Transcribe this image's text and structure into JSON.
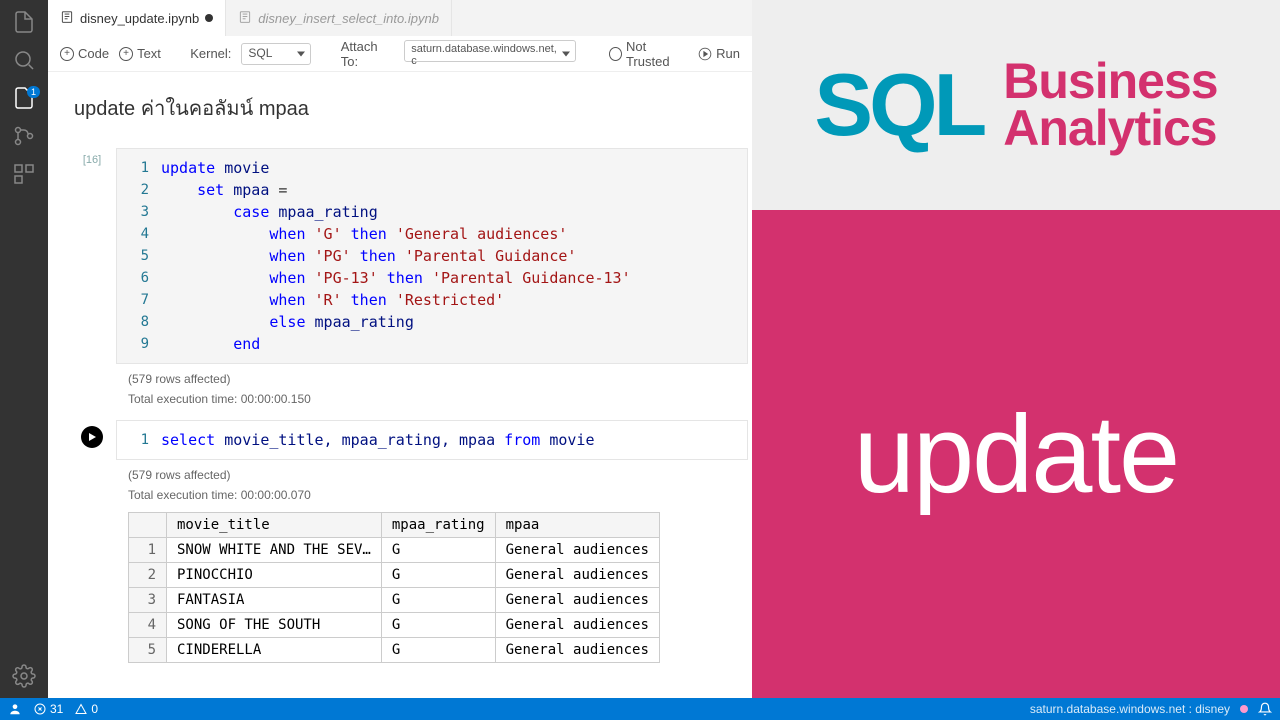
{
  "activity": {
    "badge": "1"
  },
  "tabs": [
    {
      "label": "disney_update.ipynb",
      "active": true,
      "dirty": true
    },
    {
      "label": "disney_insert_select_into.ipynb",
      "active": false,
      "dirty": false
    }
  ],
  "toolbar": {
    "code": "Code",
    "text": "Text",
    "kernel_label": "Kernel:",
    "kernel_value": "SQL",
    "attach_label": "Attach To:",
    "attach_value": "saturn.database.windows.net, c",
    "trusted": "Not Trusted",
    "run": "Run"
  },
  "heading": "update ค่าในคอลัมน์ mpaa",
  "cell1": {
    "exec_count": "[16]",
    "lines": [
      [
        {
          "t": "update",
          "c": "kw"
        },
        {
          "t": " movie",
          "c": "id"
        }
      ],
      [
        {
          "t": "    ",
          "c": "op"
        },
        {
          "t": "set",
          "c": "kw"
        },
        {
          "t": " mpaa ",
          "c": "id"
        },
        {
          "t": "=",
          "c": "op"
        }
      ],
      [
        {
          "t": "        ",
          "c": "op"
        },
        {
          "t": "case",
          "c": "kw"
        },
        {
          "t": " mpaa_rating",
          "c": "id"
        }
      ],
      [
        {
          "t": "            ",
          "c": "op"
        },
        {
          "t": "when",
          "c": "kw"
        },
        {
          "t": " ",
          "c": "op"
        },
        {
          "t": "'G'",
          "c": "str"
        },
        {
          "t": " ",
          "c": "op"
        },
        {
          "t": "then",
          "c": "kw"
        },
        {
          "t": " ",
          "c": "op"
        },
        {
          "t": "'General audiences'",
          "c": "str"
        }
      ],
      [
        {
          "t": "            ",
          "c": "op"
        },
        {
          "t": "when",
          "c": "kw"
        },
        {
          "t": " ",
          "c": "op"
        },
        {
          "t": "'PG'",
          "c": "str"
        },
        {
          "t": " ",
          "c": "op"
        },
        {
          "t": "then",
          "c": "kw"
        },
        {
          "t": " ",
          "c": "op"
        },
        {
          "t": "'Parental Guidance'",
          "c": "str"
        }
      ],
      [
        {
          "t": "            ",
          "c": "op"
        },
        {
          "t": "when",
          "c": "kw"
        },
        {
          "t": " ",
          "c": "op"
        },
        {
          "t": "'PG-13'",
          "c": "str"
        },
        {
          "t": " ",
          "c": "op"
        },
        {
          "t": "then",
          "c": "kw"
        },
        {
          "t": " ",
          "c": "op"
        },
        {
          "t": "'Parental Guidance-13'",
          "c": "str"
        }
      ],
      [
        {
          "t": "            ",
          "c": "op"
        },
        {
          "t": "when",
          "c": "kw"
        },
        {
          "t": " ",
          "c": "op"
        },
        {
          "t": "'R'",
          "c": "str"
        },
        {
          "t": " ",
          "c": "op"
        },
        {
          "t": "then",
          "c": "kw"
        },
        {
          "t": " ",
          "c": "op"
        },
        {
          "t": "'Restricted'",
          "c": "str"
        }
      ],
      [
        {
          "t": "            ",
          "c": "op"
        },
        {
          "t": "else",
          "c": "kw"
        },
        {
          "t": " mpaa_rating",
          "c": "id"
        }
      ],
      [
        {
          "t": "        ",
          "c": "op"
        },
        {
          "t": "end",
          "c": "kw"
        }
      ]
    ],
    "rows_affected": "(579 rows affected)",
    "exec_time": "Total execution time: 00:00:00.150"
  },
  "cell2": {
    "lines": [
      [
        {
          "t": "select",
          "c": "kw"
        },
        {
          "t": " movie_title, mpaa_rating, mpaa ",
          "c": "id"
        },
        {
          "t": "from",
          "c": "kw"
        },
        {
          "t": " movie",
          "c": "id"
        }
      ]
    ],
    "rows_affected": "(579 rows affected)",
    "exec_time": "Total execution time: 00:00:00.070",
    "columns": [
      "movie_title",
      "mpaa_rating",
      "mpaa"
    ],
    "rows": [
      [
        "1",
        "SNOW WHITE AND THE SEV…",
        "G",
        "General audiences"
      ],
      [
        "2",
        "PINOCCHIO",
        "G",
        "General audiences"
      ],
      [
        "3",
        "FANTASIA",
        "G",
        "General audiences"
      ],
      [
        "4",
        "SONG OF THE SOUTH",
        "G",
        "General audiences"
      ],
      [
        "5",
        "CINDERELLA",
        "G",
        "General audiences"
      ]
    ]
  },
  "right": {
    "sql": "SQL",
    "ba1": "Business",
    "ba2": "Analytics",
    "big": "update"
  },
  "status": {
    "errors": "31",
    "warnings": "0",
    "conn": "saturn.database.windows.net : disney"
  }
}
